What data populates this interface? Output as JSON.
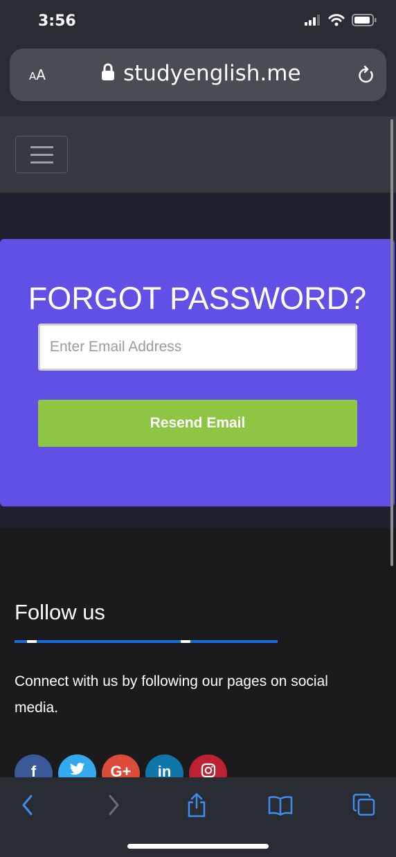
{
  "status_bar": {
    "time": "3:56"
  },
  "browser": {
    "text_size_label": "AA",
    "text_size_small": "A",
    "text_size_big": "A",
    "url": "studyenglish.me"
  },
  "forgot_password": {
    "title": "FORGOT PASSWORD?",
    "email_placeholder": "Enter Email Address",
    "email_value": "",
    "resend_label": "Resend Email"
  },
  "footer": {
    "follow_title": "Follow us",
    "follow_text": "Connect with us by following our pages on social media.",
    "social": [
      {
        "name": "facebook",
        "glyph": "f",
        "color": "#3b5998"
      },
      {
        "name": "twitter",
        "glyph": "t",
        "color": "#33aaf0"
      },
      {
        "name": "google-plus",
        "glyph": "G+",
        "color": "#dd4b39"
      },
      {
        "name": "linkedin",
        "glyph": "in",
        "color": "#0e76a8"
      },
      {
        "name": "instagram",
        "glyph": "◎",
        "color": "#bd2232"
      }
    ]
  },
  "colors": {
    "card": "#6050e6",
    "button": "#8ec643",
    "accent_line": "#1a6fe0",
    "toolbar_icon": "#3d8ef0"
  }
}
